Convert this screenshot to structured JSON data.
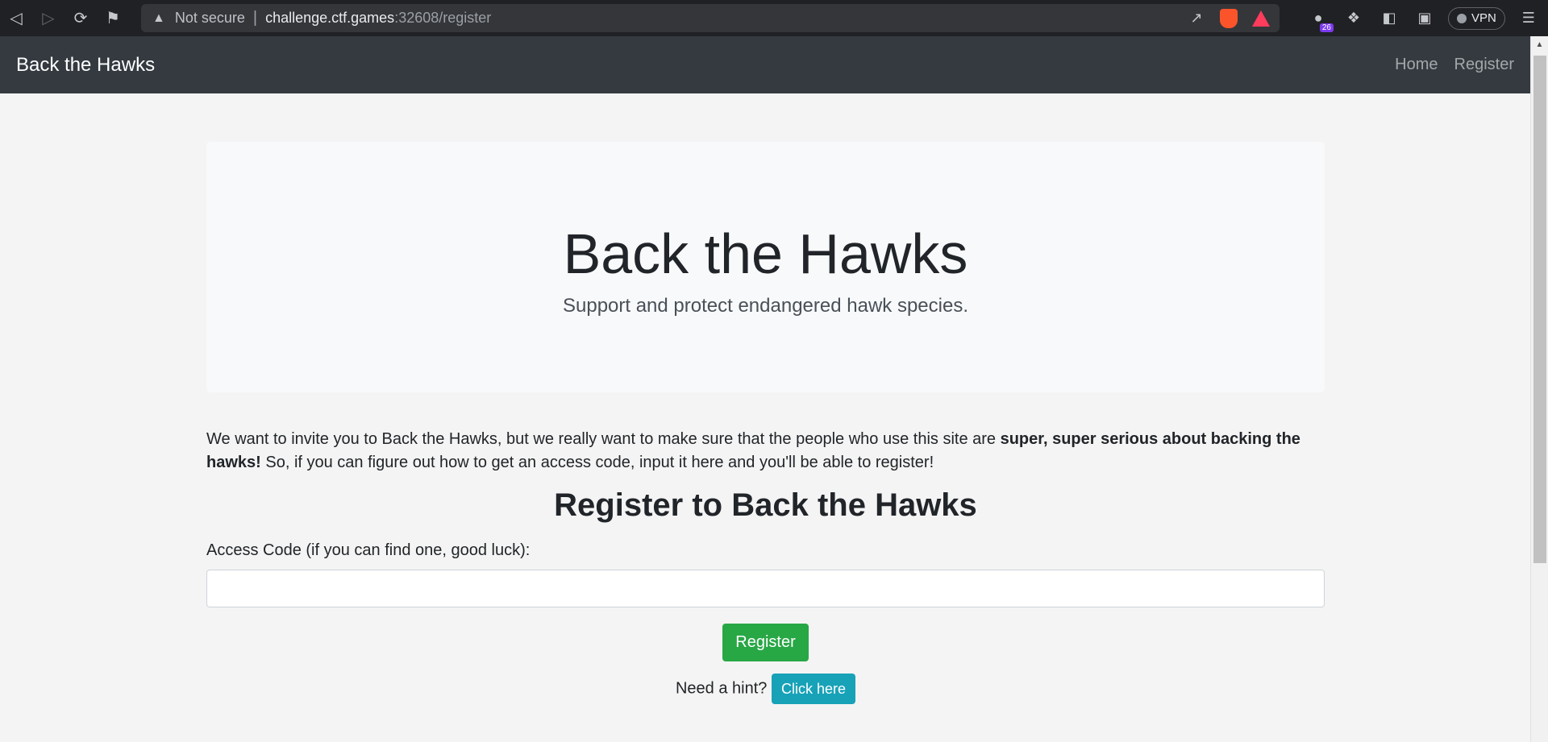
{
  "browser": {
    "security_label": "Not secure",
    "url_host": "challenge.ctf.games",
    "url_path": ":32608/register",
    "extension_badge": "26",
    "vpn_label": "VPN"
  },
  "navbar": {
    "brand": "Back the Hawks",
    "links": [
      {
        "label": "Home"
      },
      {
        "label": "Register"
      }
    ]
  },
  "jumbotron": {
    "title": "Back the Hawks",
    "subtitle": "Support and protect endangered hawk species."
  },
  "intro": {
    "text_start": "We want to invite you to Back the Hawks, but we really want to make sure that the people who use this site are ",
    "text_bold": "super, super serious about backing the hawks!",
    "text_end": " So, if you can figure out how to get an access code, input it here and you'll be able to register!"
  },
  "form": {
    "heading": "Register to Back the Hawks",
    "access_label": "Access Code (if you can find one, good luck):",
    "access_value": "",
    "submit_label": "Register"
  },
  "hint": {
    "prompt": "Need a hint?",
    "button_label": "Click here"
  },
  "colors": {
    "navbar_bg": "#343a40",
    "register_button": "#28a745",
    "hint_button": "#17a2b8"
  }
}
